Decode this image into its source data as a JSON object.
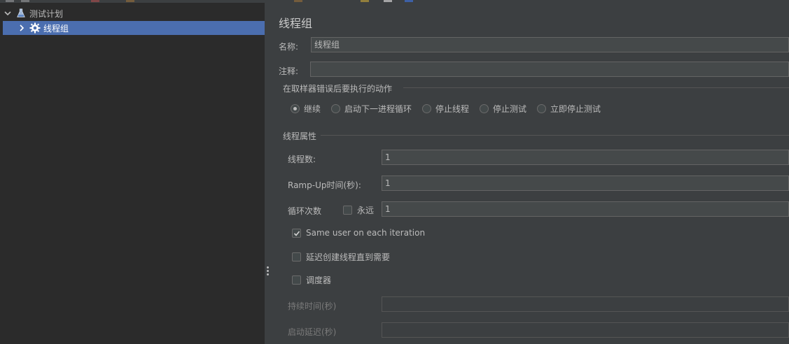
{
  "tree": {
    "items": [
      {
        "label": "测试计划",
        "icon": "flask-icon",
        "expanded": true
      },
      {
        "label": "线程组",
        "icon": "gear-icon",
        "expanded": false,
        "selected": true
      }
    ]
  },
  "panel": {
    "title": "线程组",
    "name_label": "名称:",
    "name_value": "线程组",
    "comment_label": "注释:",
    "comment_value": "",
    "on_error": {
      "heading": "在取样器错误后要执行的动作",
      "options": [
        "继续",
        "启动下一进程循环",
        "停止线程",
        "停止测试",
        "立即停止测试"
      ],
      "selected": "继续"
    },
    "thread_props": {
      "heading": "线程属性",
      "threads_label": "线程数:",
      "threads_value": "1",
      "rampup_label": "Ramp-Up时间(秒):",
      "rampup_value": "1",
      "loop_label": "循环次数",
      "forever_label": "永远",
      "forever_checked": false,
      "loop_value": "1",
      "same_user_label": "Same user on each iteration",
      "same_user_checked": true,
      "delay_create_label": "延迟创建线程直到需要",
      "delay_create_checked": false,
      "scheduler_label": "调度器",
      "scheduler_checked": false,
      "duration_label": "持续时间(秒)",
      "duration_value": "",
      "startup_delay_label": "启动延迟(秒)",
      "startup_delay_value": ""
    }
  },
  "colors": {
    "selection": "#4b6eaf",
    "panel_bg": "#3c3f41",
    "tree_bg": "#2b2b2b"
  }
}
